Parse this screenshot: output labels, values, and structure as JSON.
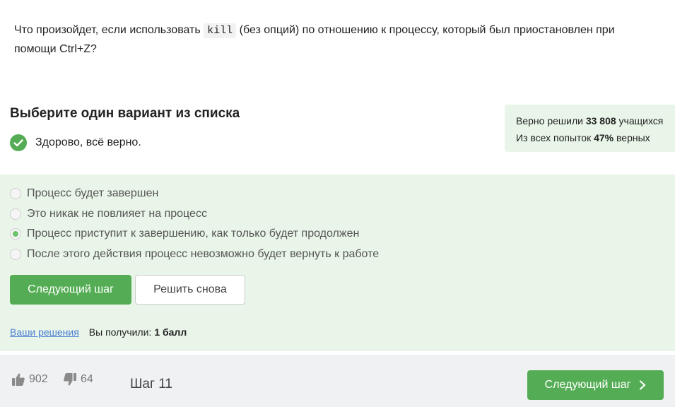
{
  "question": {
    "before": "Что произойдет, если использовать ",
    "code": "kill",
    "after": " (без опций) по отношению к процессу, который был приостановлен при помощи Ctrl+Z?"
  },
  "choose_title": "Выберите один вариант из списка",
  "feedback": {
    "icon": "check-circle-icon",
    "text": "Здорово, всё верно.",
    "color": "#54ad54"
  },
  "stats": {
    "line1_prefix": "Верно решили ",
    "line1_value": "33 808",
    "line1_suffix": " учащихся",
    "line2_prefix": "Из всех попыток ",
    "line2_value": "47%",
    "line2_suffix": " верных"
  },
  "options": [
    {
      "label": "Процесс будет завершен",
      "checked": false
    },
    {
      "label": "Это никак не повлияет на процесс",
      "checked": false
    },
    {
      "label": "Процесс приступит к завершению, как только будет продолжен",
      "checked": true
    },
    {
      "label": "После этого действия процесс невозможно будет вернуть к работе",
      "checked": false
    }
  ],
  "buttons": {
    "next_step": "Следующий шаг",
    "retry": "Решить снова"
  },
  "solutions": {
    "link": "Ваши решения",
    "score_label": "Вы получили:",
    "score_value": "1 балл"
  },
  "footer": {
    "likes": "902",
    "dislikes": "64",
    "step": "Шаг 11",
    "next_step": "Следующий шаг"
  },
  "colors": {
    "accent": "#54ad54",
    "panel_bg": "#e9f5e9",
    "link": "#4a7fd1"
  }
}
